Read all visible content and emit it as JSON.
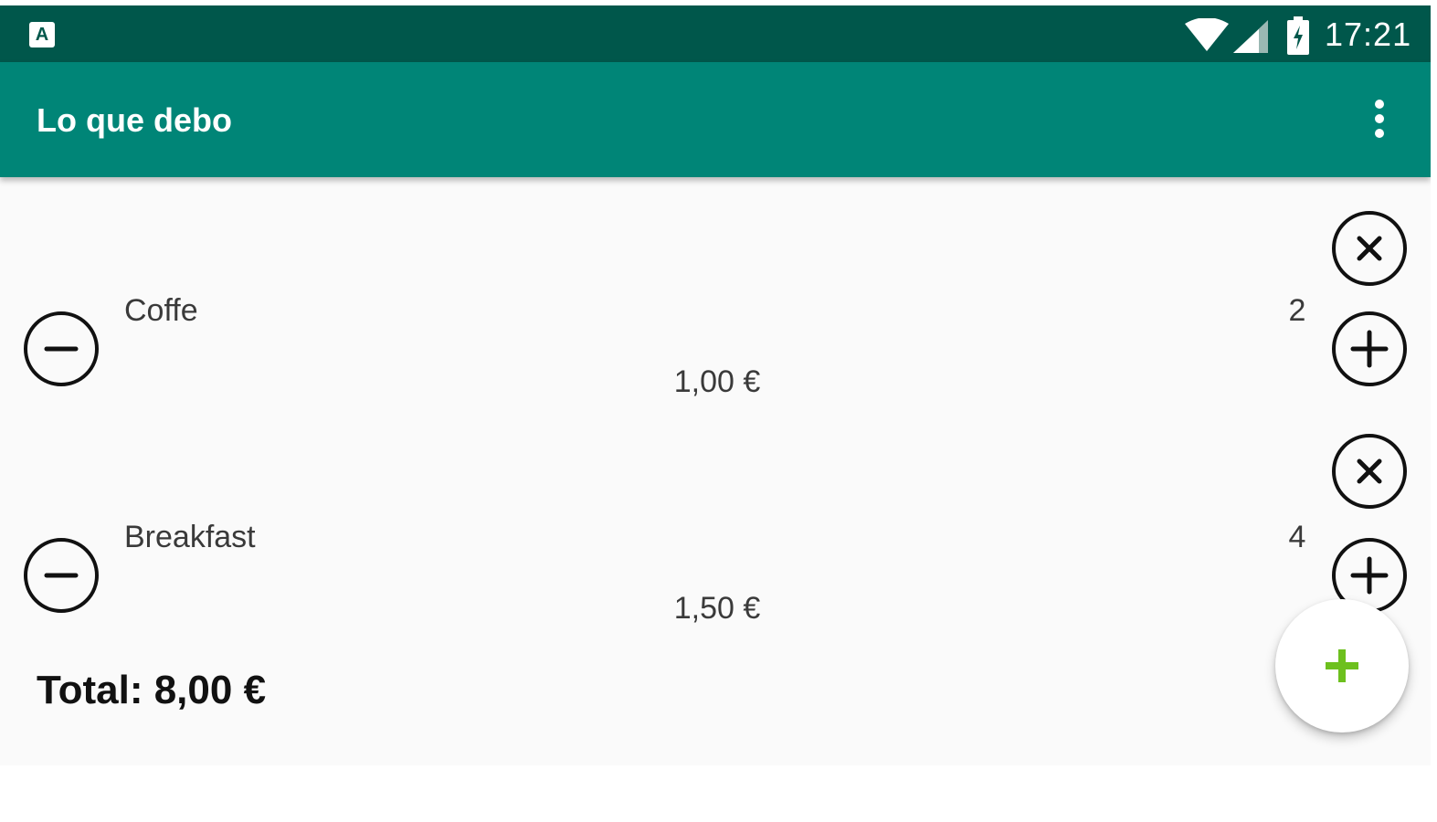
{
  "status_bar": {
    "time": "17:21",
    "notification_icon": "a-icon",
    "icons": [
      "wifi-icon",
      "signal-icon",
      "battery-charging-icon"
    ]
  },
  "app_bar": {
    "title": "Lo que debo",
    "overflow_icon": "more-vert-icon"
  },
  "items": [
    {
      "name": "Coffe",
      "price": "1,00 €",
      "quantity": "2"
    },
    {
      "name": "Breakfast",
      "price": "1,50 €",
      "quantity": "4"
    }
  ],
  "total_label": "Total: 8,00 €",
  "fab": {
    "icon": "add-icon"
  },
  "colors": {
    "status_bar": "#00574b",
    "app_bar": "#008577",
    "background": "#fafafa",
    "fab_icon": "#6dc01e"
  }
}
